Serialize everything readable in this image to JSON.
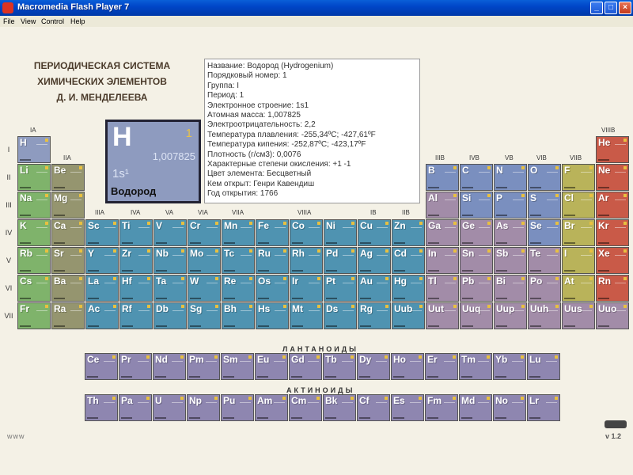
{
  "window": {
    "title": "Macromedia Flash Player 7",
    "buttons": [
      "_",
      "□",
      "×"
    ]
  },
  "menu": [
    "File",
    "View",
    "Control",
    "Help"
  ],
  "header": {
    "line1": "ПЕРИОДИЧЕСКАЯ СИСТЕМА",
    "line2": "ХИМИЧЕСКИХ ЭЛЕМЕНТОВ",
    "line3": "Д. И. МЕНДЕЛЕЕВА"
  },
  "selected": {
    "symbol": "H",
    "number": "1",
    "mass": "1,007825",
    "config": "1s¹",
    "name": "Водород"
  },
  "info": [
    "Название: Водород (Hydrogenium)",
    "Порядковый номер: 1",
    "Группа: I",
    "Период: 1",
    "Электронное строение: 1s1",
    "Атомная масса: 1,007825",
    "Электроотрицательность: 2,2",
    "Температура плавления: -255,34ºC;  -427,61ºF",
    "Температура кипения: -252,87ºC;  -423,17ºF",
    "Плотность (г/см3): 0,0076",
    "Характерные степени окисления: +1 -1",
    "Цвет элемента: Бесцветный",
    "Кем открыт: Генри Кавендиш",
    "Год открытия: 1766"
  ],
  "groups": {
    "IA": "IA",
    "IIA": "IIA",
    "IIIA": "IIIA",
    "IVA": "IVA",
    "VA": "VA",
    "VIA": "VIA",
    "VIIA": "VIIA",
    "VIIIA": "VIIIA",
    "IB": "IB",
    "IIB": "IIB",
    "IIIB": "IIIB",
    "IVB": "IVB",
    "VB": "VB",
    "VIB": "VIB",
    "VIIB": "VIIB",
    "VIIIB": "VIIIB"
  },
  "periods": [
    "I",
    "II",
    "III",
    "IV",
    "V",
    "VI",
    "VII"
  ],
  "colors": {
    "s": "#7fb36b",
    "alk": "#95956f",
    "h": "#8e9bbf",
    "d": "#4f93b1",
    "p": "#a28ca8",
    "nonmetal": "#7a8fbf",
    "halogen": "#b9b35a",
    "noble": "#c95a48",
    "f": "#8e86b0"
  },
  "elements": [
    [
      "H",
      1,
      1,
      "h"
    ],
    [
      "He",
      1,
      18,
      "noble"
    ],
    [
      "Li",
      2,
      1,
      "s"
    ],
    [
      "Be",
      2,
      2,
      "alk"
    ],
    [
      "B",
      2,
      13,
      "nonmetal"
    ],
    [
      "C",
      2,
      14,
      "nonmetal"
    ],
    [
      "N",
      2,
      15,
      "nonmetal"
    ],
    [
      "O",
      2,
      16,
      "nonmetal"
    ],
    [
      "F",
      2,
      17,
      "halogen"
    ],
    [
      "Ne",
      2,
      18,
      "noble"
    ],
    [
      "Na",
      3,
      1,
      "s"
    ],
    [
      "Mg",
      3,
      2,
      "alk"
    ],
    [
      "Al",
      3,
      13,
      "p"
    ],
    [
      "Si",
      3,
      14,
      "nonmetal"
    ],
    [
      "P",
      3,
      15,
      "nonmetal"
    ],
    [
      "S",
      3,
      16,
      "nonmetal"
    ],
    [
      "Cl",
      3,
      17,
      "halogen"
    ],
    [
      "Ar",
      3,
      18,
      "noble"
    ],
    [
      "K",
      4,
      1,
      "s"
    ],
    [
      "Ca",
      4,
      2,
      "alk"
    ],
    [
      "Sc",
      4,
      3,
      "d"
    ],
    [
      "Ti",
      4,
      4,
      "d"
    ],
    [
      "V",
      4,
      5,
      "d"
    ],
    [
      "Cr",
      4,
      6,
      "d"
    ],
    [
      "Mn",
      4,
      7,
      "d"
    ],
    [
      "Fe",
      4,
      8,
      "d"
    ],
    [
      "Co",
      4,
      9,
      "d"
    ],
    [
      "Ni",
      4,
      10,
      "d"
    ],
    [
      "Cu",
      4,
      11,
      "d"
    ],
    [
      "Zn",
      4,
      12,
      "d"
    ],
    [
      "Ga",
      4,
      13,
      "p"
    ],
    [
      "Ge",
      4,
      14,
      "p"
    ],
    [
      "As",
      4,
      15,
      "p"
    ],
    [
      "Se",
      4,
      16,
      "nonmetal"
    ],
    [
      "Br",
      4,
      17,
      "halogen"
    ],
    [
      "Kr",
      4,
      18,
      "noble"
    ],
    [
      "Rb",
      5,
      1,
      "s"
    ],
    [
      "Sr",
      5,
      2,
      "alk"
    ],
    [
      "Y",
      5,
      3,
      "d"
    ],
    [
      "Zr",
      5,
      4,
      "d"
    ],
    [
      "Nb",
      5,
      5,
      "d"
    ],
    [
      "Mo",
      5,
      6,
      "d"
    ],
    [
      "Tc",
      5,
      7,
      "d"
    ],
    [
      "Ru",
      5,
      8,
      "d"
    ],
    [
      "Rh",
      5,
      9,
      "d"
    ],
    [
      "Pd",
      5,
      10,
      "d"
    ],
    [
      "Ag",
      5,
      11,
      "d"
    ],
    [
      "Cd",
      5,
      12,
      "d"
    ],
    [
      "In",
      5,
      13,
      "p"
    ],
    [
      "Sn",
      5,
      14,
      "p"
    ],
    [
      "Sb",
      5,
      15,
      "p"
    ],
    [
      "Te",
      5,
      16,
      "p"
    ],
    [
      "I",
      5,
      17,
      "halogen"
    ],
    [
      "Xe",
      5,
      18,
      "noble"
    ],
    [
      "Cs",
      6,
      1,
      "s"
    ],
    [
      "Ba",
      6,
      2,
      "alk"
    ],
    [
      "La",
      6,
      3,
      "d"
    ],
    [
      "Hf",
      6,
      4,
      "d"
    ],
    [
      "Ta",
      6,
      5,
      "d"
    ],
    [
      "W",
      6,
      6,
      "d"
    ],
    [
      "Re",
      6,
      7,
      "d"
    ],
    [
      "Os",
      6,
      8,
      "d"
    ],
    [
      "Ir",
      6,
      9,
      "d"
    ],
    [
      "Pt",
      6,
      10,
      "d"
    ],
    [
      "Au",
      6,
      11,
      "d"
    ],
    [
      "Hg",
      6,
      12,
      "d"
    ],
    [
      "Tl",
      6,
      13,
      "p"
    ],
    [
      "Pb",
      6,
      14,
      "p"
    ],
    [
      "Bi",
      6,
      15,
      "p"
    ],
    [
      "Po",
      6,
      16,
      "p"
    ],
    [
      "At",
      6,
      17,
      "halogen"
    ],
    [
      "Rn",
      6,
      18,
      "noble"
    ],
    [
      "Fr",
      7,
      1,
      "s"
    ],
    [
      "Ra",
      7,
      2,
      "alk"
    ],
    [
      "Ac",
      7,
      3,
      "d"
    ],
    [
      "Rf",
      7,
      4,
      "d"
    ],
    [
      "Db",
      7,
      5,
      "d"
    ],
    [
      "Sg",
      7,
      6,
      "d"
    ],
    [
      "Bh",
      7,
      7,
      "d"
    ],
    [
      "Hs",
      7,
      8,
      "d"
    ],
    [
      "Mt",
      7,
      9,
      "d"
    ],
    [
      "Ds",
      7,
      10,
      "d"
    ],
    [
      "Rg",
      7,
      11,
      "d"
    ],
    [
      "Uub",
      7,
      12,
      "d"
    ],
    [
      "Uut",
      7,
      13,
      "p"
    ],
    [
      "Uuq",
      7,
      14,
      "p"
    ],
    [
      "Uup",
      7,
      15,
      "p"
    ],
    [
      "Uuh",
      7,
      16,
      "p"
    ],
    [
      "Uus",
      7,
      17,
      "p"
    ],
    [
      "Uuo",
      7,
      18,
      "p"
    ]
  ],
  "lanthanides_label": "ЛАНТАНОИДЫ",
  "actinides_label": "АКТИНОИДЫ",
  "lanthanides": [
    "Ce",
    "Pr",
    "Nd",
    "Pm",
    "Sm",
    "Eu",
    "Gd",
    "Tb",
    "Dy",
    "Ho",
    "Er",
    "Tm",
    "Yb",
    "Lu"
  ],
  "actinides": [
    "Th",
    "Pa",
    "U",
    "Np",
    "Pu",
    "Am",
    "Cm",
    "Bk",
    "Cf",
    "Es",
    "Fm",
    "Md",
    "No",
    "Lr"
  ],
  "footer": {
    "www": "www",
    "version": "v 1.2"
  }
}
